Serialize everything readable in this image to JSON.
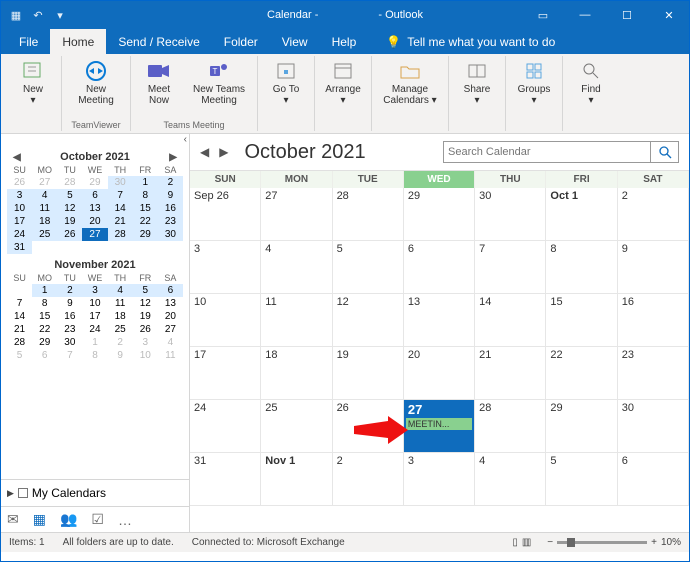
{
  "titlebar": {
    "app_left": "Calendar -",
    "app_right": "- Outlook"
  },
  "tabs": {
    "file": "File",
    "home": "Home",
    "sendreceive": "Send / Receive",
    "folder": "Folder",
    "view": "View",
    "help": "Help",
    "tell": "Tell me what you want to do"
  },
  "ribbon": {
    "new": "New",
    "new_meeting_tv": "New Meeting",
    "tv_group": "TeamViewer",
    "meet_now": "Meet Now",
    "new_teams": "New Teams Meeting",
    "teams_group": "Teams Meeting",
    "goto": "Go To",
    "arrange": "Arrange",
    "manage_cals": "Manage Calendars",
    "share": "Share",
    "groups": "Groups",
    "find": "Find"
  },
  "minical1": {
    "title": "October 2021",
    "dow": [
      "SU",
      "MO",
      "TU",
      "WE",
      "TH",
      "FR",
      "SA"
    ],
    "rows": [
      [
        "26",
        "27",
        "28",
        "29",
        "30",
        "1",
        "2"
      ],
      [
        "3",
        "4",
        "5",
        "6",
        "7",
        "8",
        "9"
      ],
      [
        "10",
        "11",
        "12",
        "13",
        "14",
        "15",
        "16"
      ],
      [
        "17",
        "18",
        "19",
        "20",
        "21",
        "22",
        "23"
      ],
      [
        "24",
        "25",
        "26",
        "27",
        "28",
        "29",
        "30"
      ],
      [
        "31",
        "",
        "",
        "",
        "",
        "",
        ""
      ]
    ]
  },
  "minical2": {
    "title": "November 2021",
    "dow": [
      "SU",
      "MO",
      "TU",
      "WE",
      "TH",
      "FR",
      "SA"
    ],
    "rows": [
      [
        "",
        "1",
        "2",
        "3",
        "4",
        "5",
        "6"
      ],
      [
        "7",
        "8",
        "9",
        "10",
        "11",
        "12",
        "13"
      ],
      [
        "14",
        "15",
        "16",
        "17",
        "18",
        "19",
        "20"
      ],
      [
        "21",
        "22",
        "23",
        "24",
        "25",
        "26",
        "27"
      ],
      [
        "28",
        "29",
        "30",
        "1",
        "2",
        "3",
        "4"
      ],
      [
        "5",
        "6",
        "7",
        "8",
        "9",
        "10",
        "11"
      ]
    ]
  },
  "mycals_label": "My Calendars",
  "main": {
    "month_title": "October 2021",
    "search_placeholder": "Search Calendar",
    "dow": [
      "SUN",
      "MON",
      "TUE",
      "WED",
      "THU",
      "FRI",
      "SAT"
    ],
    "cells": [
      [
        "Sep 26",
        "27",
        "28",
        "29",
        "30",
        "Oct 1",
        "2"
      ],
      [
        "3",
        "4",
        "5",
        "6",
        "7",
        "8",
        "9"
      ],
      [
        "10",
        "11",
        "12",
        "13",
        "14",
        "15",
        "16"
      ],
      [
        "17",
        "18",
        "19",
        "20",
        "21",
        "22",
        "23"
      ],
      [
        "24",
        "25",
        "26",
        "27",
        "28",
        "29",
        "30"
      ],
      [
        "31",
        "Nov 1",
        "2",
        "3",
        "4",
        "5",
        "6"
      ]
    ],
    "event_label": "MEETIN..."
  },
  "status": {
    "items": "Items: 1",
    "folders": "All folders are up to date.",
    "connected": "Connected to: Microsoft Exchange",
    "zoom": "10%"
  }
}
